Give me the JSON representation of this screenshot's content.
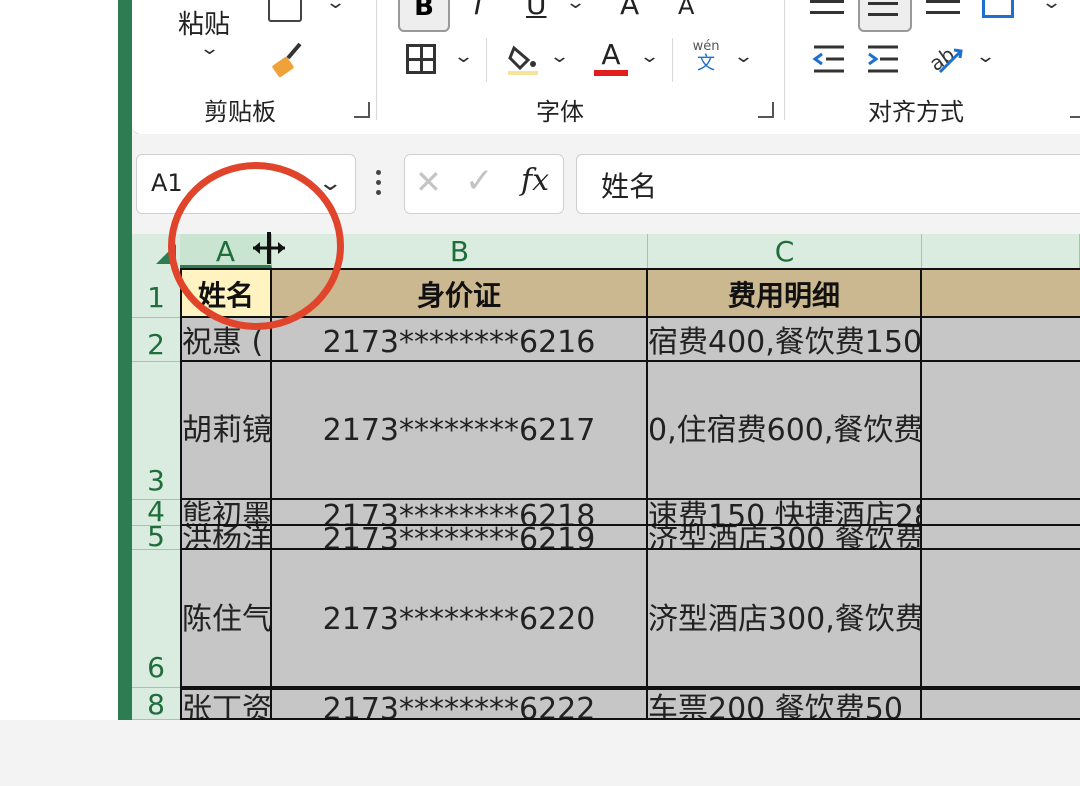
{
  "ribbon": {
    "paste_label": "粘贴",
    "groups": {
      "clipboard": "剪贴板",
      "font": "字体",
      "alignment": "对齐方式"
    },
    "font_buttons": {
      "bold": "B",
      "italic": "I",
      "underline": "U",
      "grow": "A",
      "shrink": "A",
      "font_color": "A"
    },
    "phonetic": {
      "top": "wén",
      "bottom": "文"
    },
    "font_color_bar": "#e11d1d"
  },
  "formula_bar": {
    "name_box": "A1",
    "fx_label": "fx",
    "content": "姓名"
  },
  "columns": [
    "A",
    "B",
    "C"
  ],
  "rows": [
    {
      "num": "1",
      "a": "姓名",
      "b": "身价证",
      "c": "费用明细"
    },
    {
      "num": "2",
      "a": "祝惠 (",
      "b": "2173********6216",
      "c": "宿费400,餐饮费150"
    },
    {
      "num": "3",
      "a": "胡莉镜",
      "b": "2173********6217",
      "c": "0,住宿费600,餐饮费"
    },
    {
      "num": "4",
      "a": "熊初墨",
      "b": "2173********6218",
      "c": "速费150 快捷酒店28"
    },
    {
      "num": "5",
      "a": "洪杨洋",
      "b": "2173********6219",
      "c": "济型酒店300 餐饮费"
    },
    {
      "num": "6",
      "a": "陈住气",
      "b": "2173********6220",
      "c": "济型酒店300,餐饮费"
    },
    {
      "num": "8",
      "a": "张丁资",
      "b": "2173********6222",
      "c": "车票200 餐饮费50"
    }
  ],
  "colors": {
    "accent": "#2e7d52",
    "header_fill": "#cbb890",
    "selection_gray": "#c6c6c6",
    "annotation": "#e0452b"
  }
}
